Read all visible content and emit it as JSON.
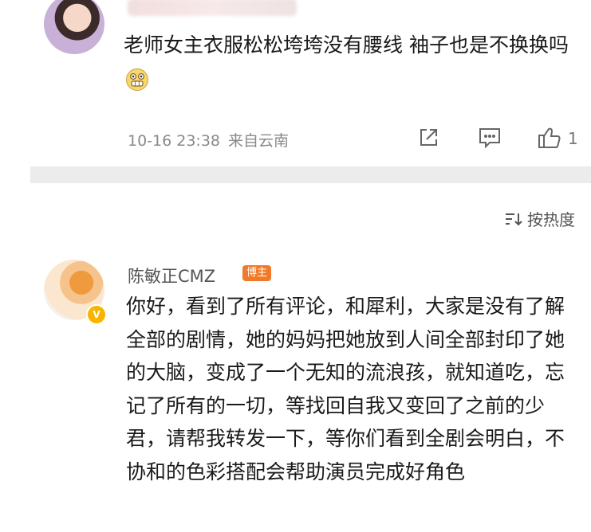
{
  "comment1": {
    "text": "老师女主衣服松松垮垮没有腰线 袖子也是不换换吗",
    "emoji_icon": "grimace-emoji-icon",
    "time": "10-16 23:38",
    "location": "来自云南",
    "actions": {
      "share_icon": "share-icon",
      "comment_icon": "comment-icon",
      "like_icon": "thumbs-up-icon",
      "like_count": "1"
    }
  },
  "sort": {
    "icon": "sort-icon",
    "label": "按热度"
  },
  "comment2": {
    "author": "陈敏正CMZ",
    "badge": "博主",
    "verified_icon": "verified-badge-icon",
    "text": "你好，看到了所有评论，和犀利，大家是没有了解全部的剧情，她的妈妈把她放到人间全部封印了她的大脑，变成了一个无知的流浪孩，就知道吃，忘记了所有的一切，等找回自我又变回了之前的少君，请帮我转发一下，等你们看到全剧会明白，不协和的色彩搭配会帮助演员完成好角色"
  },
  "colors": {
    "accent_badge": "#f07a2a",
    "verified": "#f7b500",
    "divider": "#ececec",
    "meta_text": "#8a8a8a"
  }
}
